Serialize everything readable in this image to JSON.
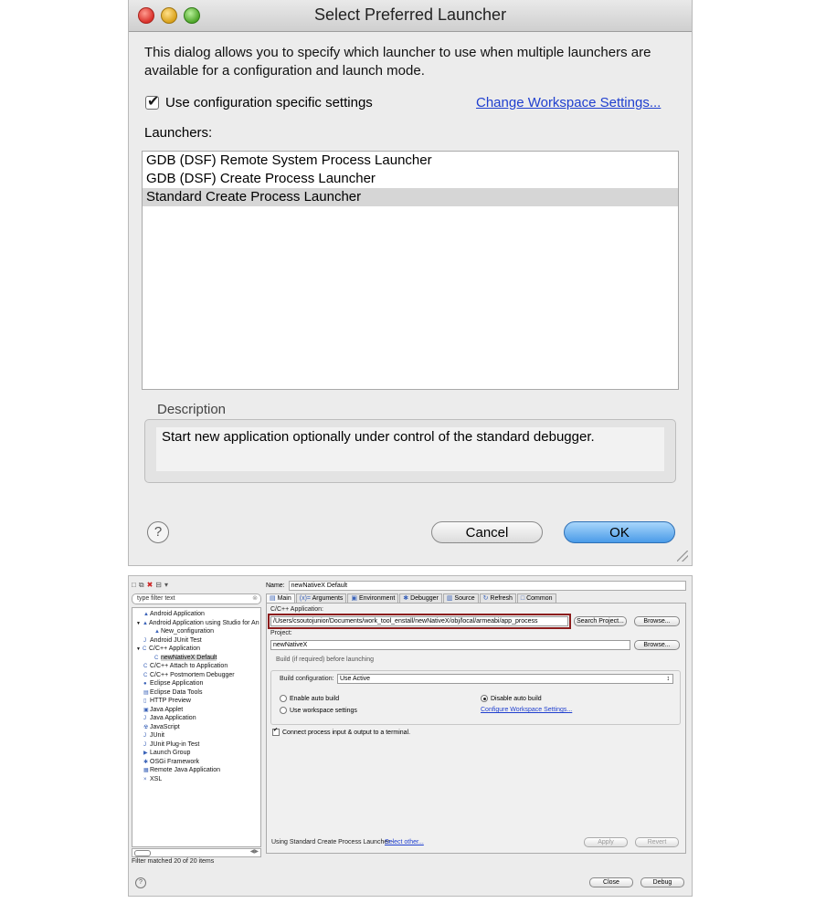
{
  "dialog": {
    "title": "Select Preferred Launcher",
    "intro": "This dialog allows you to specify which launcher to use when multiple launchers are available for a configuration and launch mode.",
    "use_config_label": "Use configuration specific settings",
    "use_config_checked": true,
    "change_workspace_link": "Change Workspace Settings...",
    "launchers_label": "Launchers:",
    "launchers": [
      "GDB (DSF) Remote System Process Launcher",
      "GDB (DSF) Create Process Launcher",
      "Standard Create Process Launcher"
    ],
    "selected_launcher": "Standard Create Process Launcher",
    "description_label": "Description",
    "description_text": "Start new application optionally under control of the standard debugger.",
    "help_glyph": "?",
    "cancel_label": "Cancel",
    "ok_label": "OK"
  },
  "launch_config": {
    "filter_placeholder": "type filter text",
    "tree": [
      {
        "label": "Android Application",
        "icon": "android-icon"
      },
      {
        "label": "Android Application using Studio for An",
        "icon": "android-icon"
      },
      {
        "label": "New_configuration",
        "icon": "android-icon"
      },
      {
        "label": "Android JUnit Test",
        "icon": "junit-icon"
      },
      {
        "label": "C/C++ Application",
        "icon": "c-app-icon"
      },
      {
        "label": "newNativeX Default",
        "icon": "c-app-icon"
      },
      {
        "label": "C/C++ Attach to Application",
        "icon": "c-app-icon"
      },
      {
        "label": "C/C++ Postmortem Debugger",
        "icon": "c-app-icon"
      },
      {
        "label": "Eclipse Application",
        "icon": "eclipse-icon"
      },
      {
        "label": "Eclipse Data Tools",
        "icon": "data-tools-icon"
      },
      {
        "label": "HTTP Preview",
        "icon": "http-icon"
      },
      {
        "label": "Java Applet",
        "icon": "applet-icon"
      },
      {
        "label": "Java Application",
        "icon": "java-icon"
      },
      {
        "label": "JavaScript",
        "icon": "javascript-icon"
      },
      {
        "label": "JUnit",
        "icon": "junit-icon"
      },
      {
        "label": "JUnit Plug-in Test",
        "icon": "junit-icon"
      },
      {
        "label": "Launch Group",
        "icon": "launch-group-icon"
      },
      {
        "label": "OSGi Framework",
        "icon": "osgi-icon"
      },
      {
        "label": "Remote Java Application",
        "icon": "remote-java-icon"
      },
      {
        "label": "XSL",
        "icon": "xsl-icon"
      }
    ],
    "filter_status": "Filter matched 20 of 20 items",
    "name_label": "Name:",
    "name_value": "newNativeX Default",
    "tabs": [
      "Main",
      "Arguments",
      "Environment",
      "Debugger",
      "Source",
      "Refresh",
      "Common"
    ],
    "active_tab": "Main",
    "app_label": "C/C++ Application:",
    "app_path": "/Users/csoutojunior/Documents/work_tool_enstall/newNativeX/obj/local/armeabi/app_process",
    "search_project": "Search Project...",
    "browse": "Browse...",
    "project_label": "Project:",
    "project_value": "newNativeX",
    "build_group_label": "Build (if required) before launching",
    "build_config_label": "Build configuration:",
    "build_config_value": "Use Active",
    "enable_auto_build": "Enable auto build",
    "disable_auto_build": "Disable auto build",
    "use_workspace_settings": "Use workspace settings",
    "configure_workspace_link": "Configure Workspace Settings...",
    "connect_terminal": "Connect process input & output to a terminal.",
    "using_launcher_text": "Using Standard Create Process Launcher -",
    "select_other_link": "Select other...",
    "apply_label": "Apply",
    "revert_label": "Revert",
    "close_label": "Close",
    "debug_label": "Debug"
  }
}
